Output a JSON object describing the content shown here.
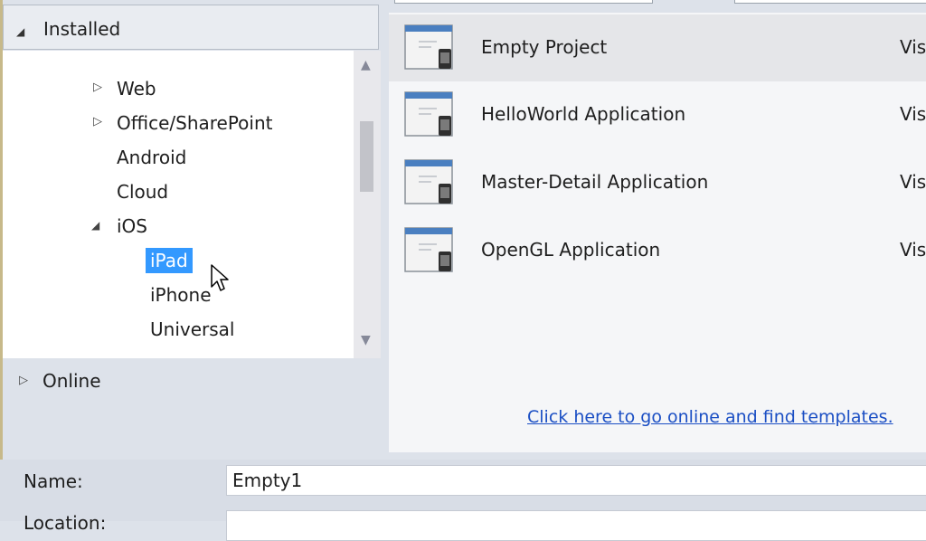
{
  "tree": {
    "installed_label": "Installed",
    "items": [
      {
        "label": "Web"
      },
      {
        "label": "Office/SharePoint"
      },
      {
        "label": "Android"
      },
      {
        "label": "Cloud"
      },
      {
        "label": "iOS"
      },
      {
        "label": "iPad"
      },
      {
        "label": "iPhone"
      },
      {
        "label": "Universal"
      }
    ],
    "selected": "iPad",
    "online_label": "Online"
  },
  "templates": {
    "items": [
      {
        "name": "Empty Project",
        "lang": "Vis"
      },
      {
        "name": "HelloWorld Application",
        "lang": "Vis"
      },
      {
        "name": "Master-Detail Application",
        "lang": "Vis"
      },
      {
        "name": "OpenGL Application",
        "lang": "Vis"
      }
    ],
    "selected": "Empty Project",
    "online_link": "Click here to go online and find templates."
  },
  "form": {
    "name_label": "Name:",
    "name_value": "Empty1",
    "location_label": "Location:"
  },
  "colors": {
    "selection": "#3399ff",
    "link": "#1b4fc4"
  },
  "icons": {
    "template": "ios-template-icon",
    "expand": "triangle-right-icon",
    "collapse": "triangle-down-icon"
  }
}
